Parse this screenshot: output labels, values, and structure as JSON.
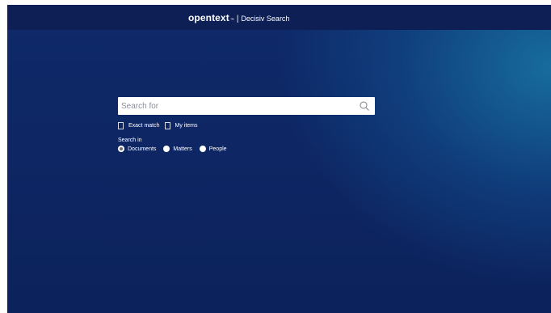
{
  "header": {
    "logo_text": "opentext",
    "trademark": "™",
    "separator": "|",
    "product_name": "Decisiv Search"
  },
  "search": {
    "placeholder": "Search for",
    "value": "",
    "icon": "search-icon"
  },
  "options": {
    "exact_match_label": "Exact match",
    "exact_match_checked": false,
    "my_items_label": "My items",
    "my_items_checked": false
  },
  "search_in": {
    "label": "Search in",
    "selected": "Documents",
    "options": [
      "Documents",
      "Matters",
      "People"
    ]
  },
  "colors": {
    "header_bg": "#0d1f55",
    "background_dark": "#0c225c",
    "background_glow": "#1878a8"
  }
}
